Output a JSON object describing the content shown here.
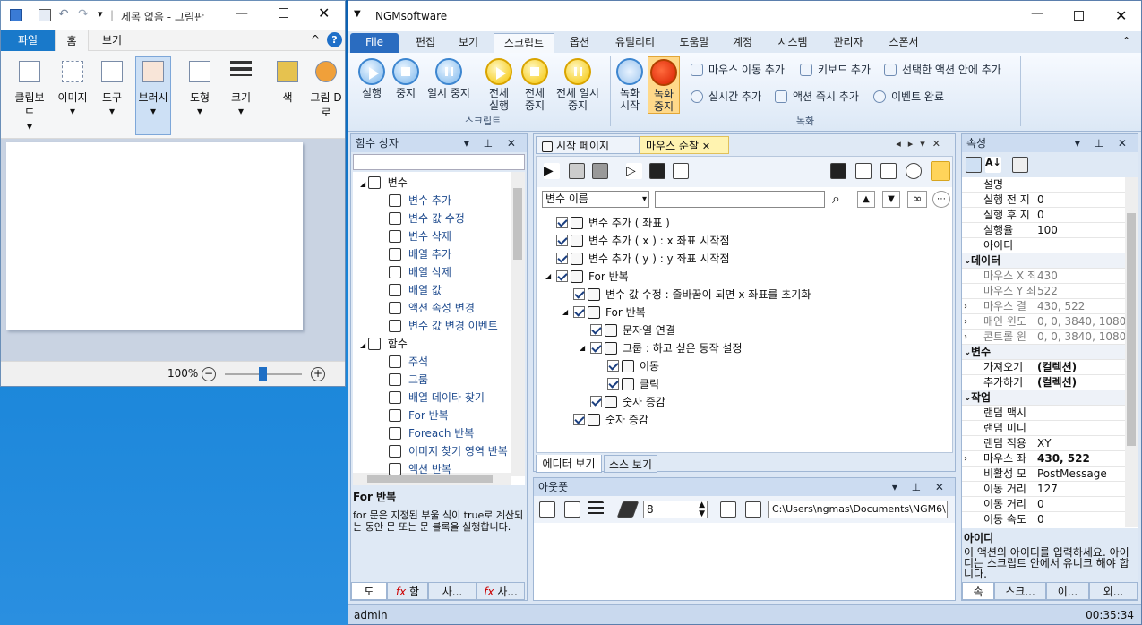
{
  "paint": {
    "title": "제목 없음 - 그림판",
    "tabs": [
      "파일",
      "홈",
      "보기"
    ],
    "tools": [
      "클립보드",
      "이미지",
      "도구",
      "브러시",
      "도형",
      "크기",
      "색",
      "그림 D로"
    ],
    "zoom": "100%"
  },
  "ngm": {
    "title": "NGMsoftware",
    "tabs": [
      "File",
      "편집",
      "보기",
      "스크립트",
      "옵션",
      "유틸리티",
      "도움말",
      "계정",
      "시스템",
      "관리자",
      "스폰서"
    ],
    "ribbon": {
      "script_buttons": [
        "실행",
        "중지",
        "일시 중지",
        "전체 실행",
        "전체 중지",
        "전체 일시 중지"
      ],
      "script_group": "스크립트",
      "record_buttons": [
        "녹화 시작",
        "녹화 중지"
      ],
      "record_items": [
        "마우스 이동 추가",
        "키보드 추가",
        "선택한 액션 안에 추가",
        "실시간 추가",
        "액션 즉시 추가",
        "이벤트 완료"
      ],
      "record_group": "녹화"
    },
    "func_panel": {
      "title": "함수 상자",
      "search_value": "",
      "items": [
        {
          "label": "변수",
          "level": 0,
          "kind": "group"
        },
        {
          "label": "변수 추가",
          "level": 1
        },
        {
          "label": "변수 값 수정",
          "level": 1
        },
        {
          "label": "변수 삭제",
          "level": 1
        },
        {
          "label": "배열 추가",
          "level": 1
        },
        {
          "label": "배열 삭제",
          "level": 1
        },
        {
          "label": "배열 값",
          "level": 1
        },
        {
          "label": "액션 속성 변경",
          "level": 1
        },
        {
          "label": "변수 값 변경 이벤트",
          "level": 1
        },
        {
          "label": "함수",
          "level": 0,
          "kind": "group"
        },
        {
          "label": "주석",
          "level": 1
        },
        {
          "label": "그룹",
          "level": 1
        },
        {
          "label": "배열 데이타 찾기",
          "level": 1
        },
        {
          "label": "For 반복",
          "level": 1
        },
        {
          "label": "Foreach 반복",
          "level": 1
        },
        {
          "label": "이미지 찾기 영역 반복",
          "level": 1
        },
        {
          "label": "액션 반복",
          "level": 1
        }
      ],
      "help_title": "For 반복",
      "help_text": "for 문은 지정된 부울 식이 true로 계산되는 동안 문 또는 문 블록을 실행합니다.",
      "bottom_tabs": [
        "도",
        "함",
        "사...",
        "사..."
      ]
    },
    "doc": {
      "tabs": [
        "시작 페이지",
        "마우스 순찰"
      ],
      "var_select": "변수 이름",
      "search_value": "",
      "tree": [
        {
          "text": "변수 추가 ( 좌표 )",
          "indent": 0
        },
        {
          "text": "변수 추가 ( x ) : x 좌표 시작점",
          "indent": 0
        },
        {
          "text": "변수 추가 ( y ) : y 좌표 시작점",
          "indent": 0
        },
        {
          "text": "For 반복",
          "indent": 0,
          "expand": true
        },
        {
          "text": "변수 값 수정 : 줄바꿈이 되면 x 좌표를 초기화",
          "indent": 1
        },
        {
          "text": "For 반복",
          "indent": 1,
          "expand": true
        },
        {
          "text": "문자열 연결",
          "indent": 2
        },
        {
          "text": "그룹 : 하고 싶은 동작 설정",
          "indent": 2,
          "expand": true
        },
        {
          "text": "이동",
          "indent": 3
        },
        {
          "text": "클릭",
          "indent": 3
        },
        {
          "text": "숫자 증감",
          "indent": 2
        },
        {
          "text": "숫자 증감",
          "indent": 1
        }
      ],
      "bottom_tabs": [
        "에디터 보기",
        "소스 보기"
      ]
    },
    "output": {
      "title": "아웃풋",
      "number": "8",
      "path": "C:\\Users\\ngmas\\Documents\\NGM6\\"
    },
    "props": {
      "title": "속성",
      "rows": [
        {
          "k": "설명",
          "v": ""
        },
        {
          "k": "실행 전 지",
          "v": "0"
        },
        {
          "k": "실행 후 지",
          "v": "0"
        },
        {
          "k": "실행율",
          "v": "100"
        },
        {
          "k": "아이디",
          "v": ""
        },
        {
          "k": "데이터",
          "v": "",
          "cat": true
        },
        {
          "k": "마우스 X 좌",
          "v": "430",
          "ro": true
        },
        {
          "k": "마우스 Y 좌",
          "v": "522",
          "ro": true
        },
        {
          "k": "마우스 결",
          "v": "430, 522",
          "ro": true,
          "exp": true
        },
        {
          "k": "매인 윈도",
          "v": "0, 0, 3840, 1080",
          "ro": true,
          "exp": true
        },
        {
          "k": "콘트롤 윈",
          "v": "0, 0, 3840, 1080",
          "ro": true,
          "exp": true
        },
        {
          "k": "변수",
          "v": "",
          "cat": true
        },
        {
          "k": "가져오기",
          "v": "(컬렉션)",
          "bold": true
        },
        {
          "k": "추가하기",
          "v": "(컬렉션)",
          "bold": true
        },
        {
          "k": "작업",
          "v": "",
          "cat": true
        },
        {
          "k": "랜덤 맥시",
          "v": ""
        },
        {
          "k": "랜덤 미니",
          "v": ""
        },
        {
          "k": "랜덤 적용",
          "v": "XY"
        },
        {
          "k": "마우스 좌",
          "v": "430, 522",
          "bold": true,
          "exp": true
        },
        {
          "k": "비활성 모",
          "v": "PostMessage"
        },
        {
          "k": "이동 거리",
          "v": "127"
        },
        {
          "k": "이동 거리",
          "v": "0"
        },
        {
          "k": "이동 속도",
          "v": "0"
        }
      ],
      "help_title": "아이디",
      "help_text": "이 액션의 아이디를 입력하세요. 아이디는 스크립트 안에서 유니크 해야 합니다.",
      "bottom_tabs": [
        "속",
        "스크...",
        "이...",
        "외..."
      ]
    },
    "status": {
      "user": "admin",
      "time": "00:35:34"
    }
  }
}
